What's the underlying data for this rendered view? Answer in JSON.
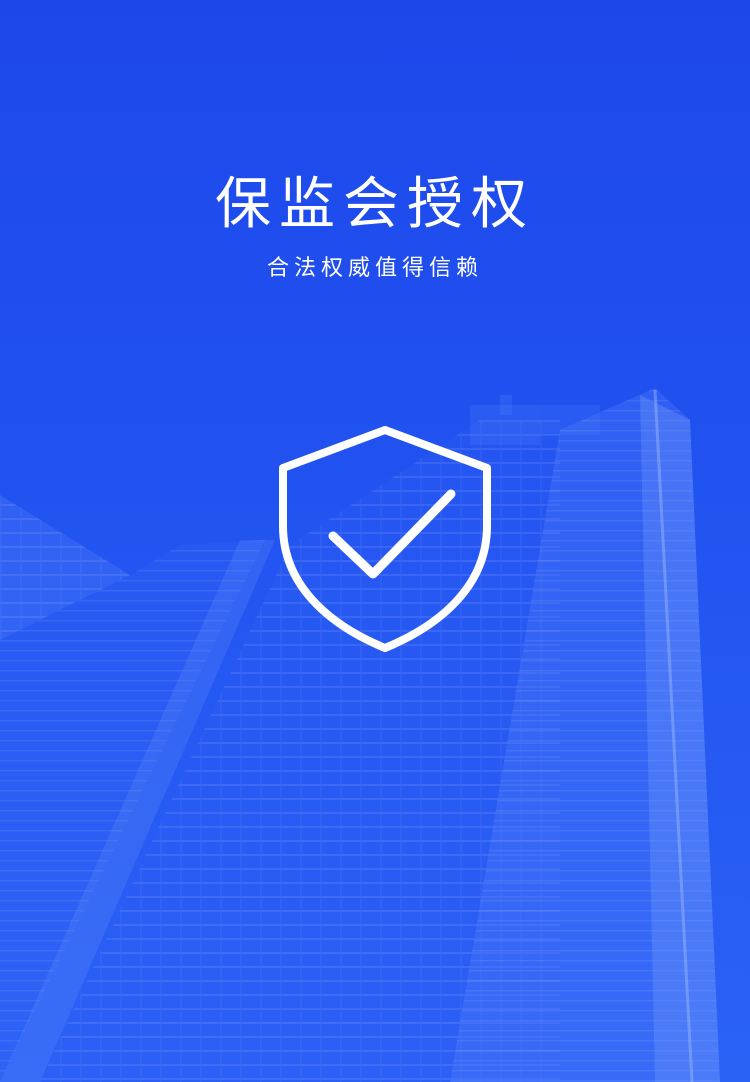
{
  "hero": {
    "title": "保监会授权",
    "subtitle": "合法权威值得信赖",
    "icon": "shield-check-icon"
  },
  "colors": {
    "background_top": "#1e47ea",
    "background_bottom": "#2b62f6",
    "text": "#ffffff",
    "icon_stroke": "#ffffff"
  }
}
